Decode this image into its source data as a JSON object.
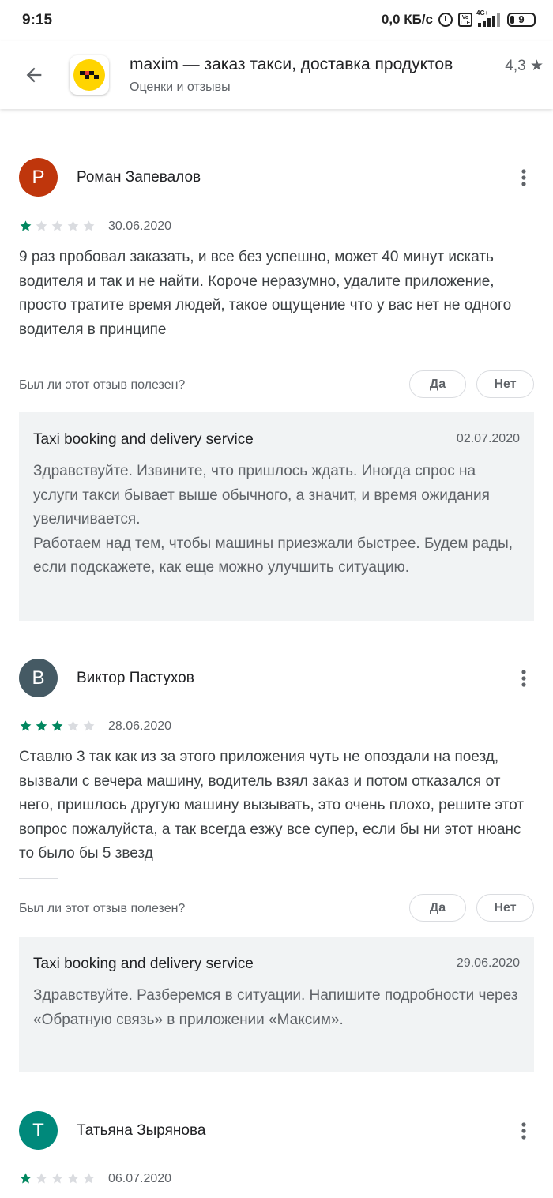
{
  "status_bar": {
    "time": "9:15",
    "net_speed": "0,0 КБ/с",
    "volte": "Vo LTE",
    "network": "4G+",
    "battery": "9"
  },
  "header": {
    "title": "maxim — заказ такси, доставка продуктов",
    "subtitle": "Оценки и отзывы",
    "rating": "4,3 ★"
  },
  "reviews": [
    {
      "avatar_letter": "Р",
      "avatar_color": "#bf360c",
      "name": "Роман Запевалов",
      "rating": 1,
      "date": "30.06.2020",
      "text": "9 раз пробовал заказать, и все без успешно, может 40 минут искать водителя и так и не найти. Короче неразумно, удалите приложение, просто тратите время людей, такое ощущение что у вас нет не одного водителя в принципе",
      "helpful_question": "Был ли этот отзыв полезен?",
      "yes_label": "Да",
      "no_label": "Нет",
      "reply": {
        "developer": "Taxi booking and delivery service",
        "date": "02.07.2020",
        "paragraphs": [
          "Здравствуйте. Извините, что пришлось ждать. Иногда спрос на услуги такси бывает выше обычного, а значит, и время ожидания увеличивается.",
          "Работаем над тем, чтобы машины приезжали быстрее. Будем рады, если подскажете, как еще можно улучшить ситуацию."
        ]
      }
    },
    {
      "avatar_letter": "В",
      "avatar_color": "#455a64",
      "name": "Виктор Пастухов",
      "rating": 3,
      "date": "28.06.2020",
      "text": "Ставлю 3 так как из за этого приложения чуть не опоздали на поезд, вызвали с вечера машину, водитель взял заказ и потом отказался от него, пришлось другую машину вызывать, это очень плохо, решите этот вопрос пожалуйста, а так всегда езжу все супер, если бы ни этот нюанс то было бы 5 звезд",
      "helpful_question": "Был ли этот отзыв полезен?",
      "yes_label": "Да",
      "no_label": "Нет",
      "reply": {
        "developer": "Taxi booking and delivery service",
        "date": "29.06.2020",
        "paragraphs": [
          "Здравствуйте. Разберемся в ситуации. Напишите подробности через «Обратную связь» в приложении «Максим»."
        ]
      }
    },
    {
      "avatar_letter": "Т",
      "avatar_color": "#00897b",
      "name": "Татьяна Зырянова",
      "rating": 1,
      "date": "06.07.2020"
    }
  ],
  "colors": {
    "star_filled": "#01875f",
    "star_empty": "#dadce0"
  }
}
